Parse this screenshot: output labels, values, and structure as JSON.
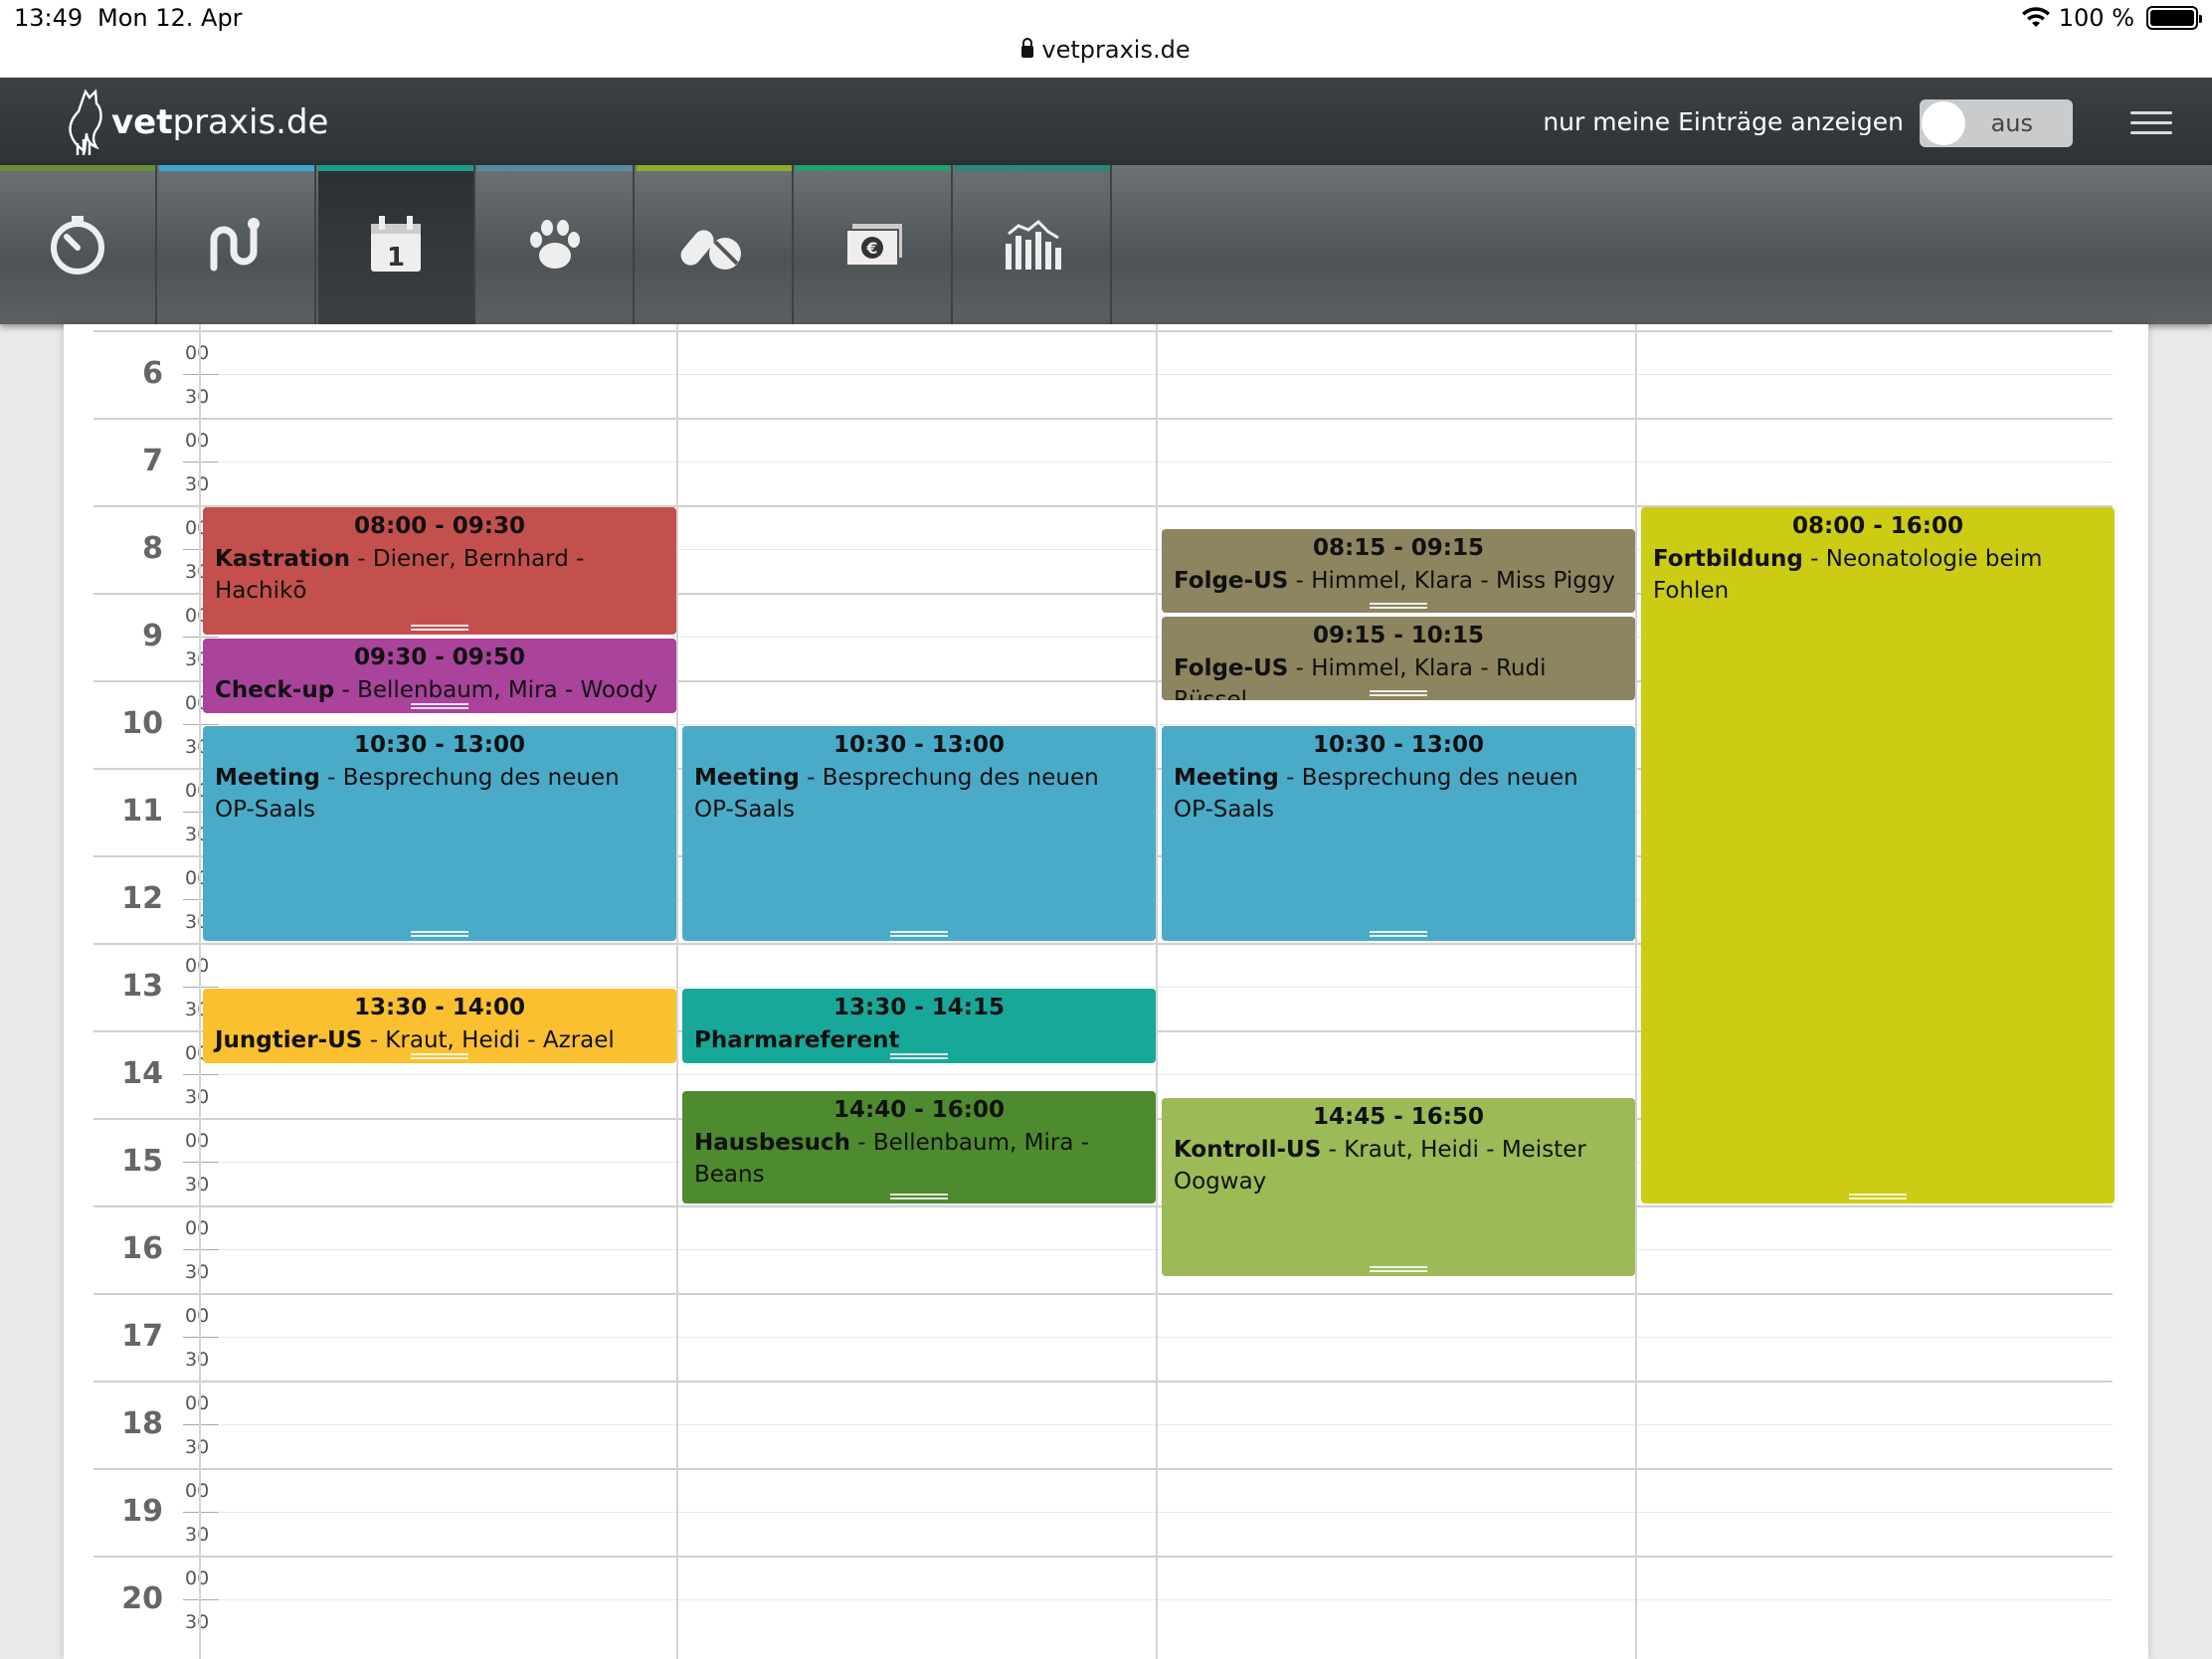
{
  "status_bar": {
    "time": "13:49",
    "date": "Mon 12. Apr",
    "battery": "100 %",
    "url": "vetpraxis.de"
  },
  "header": {
    "logo_bold": "vet",
    "logo_rest": "praxis.de",
    "filter_label": "nur meine Einträge anzeigen",
    "toggle_state": "aus"
  },
  "toolbar": {
    "tools": [
      {
        "icon": "stopwatch-icon",
        "accent": "#6a8d3a"
      },
      {
        "icon": "route-icon",
        "accent": "#3aa6d0"
      },
      {
        "icon": "calendar-icon",
        "accent": "#1b9c8a"
      },
      {
        "icon": "paw-icon",
        "accent": "#5a8aa0"
      },
      {
        "icon": "pills-icon",
        "accent": "#8aae2a"
      },
      {
        "icon": "money-icon",
        "accent": "#22a070"
      },
      {
        "icon": "chart-icon",
        "accent": "#2a8a7a"
      }
    ]
  },
  "calendar": {
    "hours": [
      "6",
      "7",
      "8",
      "9",
      "10",
      "11",
      "12",
      "13",
      "14",
      "15",
      "16",
      "17",
      "18",
      "19",
      "20"
    ],
    "minute_labels": [
      "00",
      "30"
    ],
    "columns": 4,
    "events": [
      {
        "column": 0,
        "start": 8.0,
        "end": 9.5,
        "time": "08:00 - 09:30",
        "title": "Kastration",
        "detail": " - Diener, Bernhard - Hachikō",
        "color": "#c4504e"
      },
      {
        "column": 0,
        "start": 9.5,
        "end": 10.4,
        "time": "09:30 - 09:50",
        "title": "Check-up",
        "detail": " - Bellenbaum, Mira - Woody",
        "color": "#a9439c"
      },
      {
        "column": 0,
        "start": 10.5,
        "end": 13.0,
        "time": "10:30 - 13:00",
        "title": "Meeting",
        "detail": " - Besprechung des neuen OP-Saals",
        "color": "#4aabc8"
      },
      {
        "column": 0,
        "start": 13.5,
        "end": 14.4,
        "time": "13:30 - 14:00",
        "title": "Jungtier-US",
        "detail": " - Kraut, Heidi - Azrael",
        "color": "#fbc030"
      },
      {
        "column": 1,
        "start": 10.5,
        "end": 13.0,
        "time": "10:30 - 13:00",
        "title": "Meeting",
        "detail": " - Besprechung des neuen OP-Saals",
        "color": "#4aabc8"
      },
      {
        "column": 1,
        "start": 13.5,
        "end": 14.4,
        "time": "13:30 - 14:15",
        "title": "Pharmareferent",
        "detail": "",
        "color": "#18a89a"
      },
      {
        "column": 1,
        "start": 14.67,
        "end": 16.0,
        "time": "14:40 - 16:00",
        "title": "Hausbesuch",
        "detail": " - Bellenbaum, Mira - Beans",
        "color": "#4e8a2e"
      },
      {
        "column": 2,
        "start": 8.25,
        "end": 9.25,
        "time": "08:15 - 09:15",
        "title": "Folge-US",
        "detail": " - Himmel, Klara - Miss Piggy",
        "color": "#8c8560"
      },
      {
        "column": 2,
        "start": 9.25,
        "end": 10.25,
        "time": "09:15 - 10:15",
        "title": "Folge-US",
        "detail": " - Himmel, Klara - Rudi Rüssel",
        "color": "#8c8560"
      },
      {
        "column": 2,
        "start": 10.5,
        "end": 13.0,
        "time": "10:30 - 13:00",
        "title": "Meeting",
        "detail": " - Besprechung des neuen OP-Saals",
        "color": "#4aabc8"
      },
      {
        "column": 2,
        "start": 14.75,
        "end": 16.83,
        "time": "14:45 - 16:50",
        "title": "Kontroll-US",
        "detail": " - Kraut, Heidi - Meister Oogway",
        "color": "#9cbb57"
      },
      {
        "column": 3,
        "start": 8.0,
        "end": 16.0,
        "time": "08:00 - 16:00",
        "title": "Fortbildung",
        "detail": " - Neonatologie beim Fohlen",
        "color": "#cccc14"
      }
    ]
  }
}
